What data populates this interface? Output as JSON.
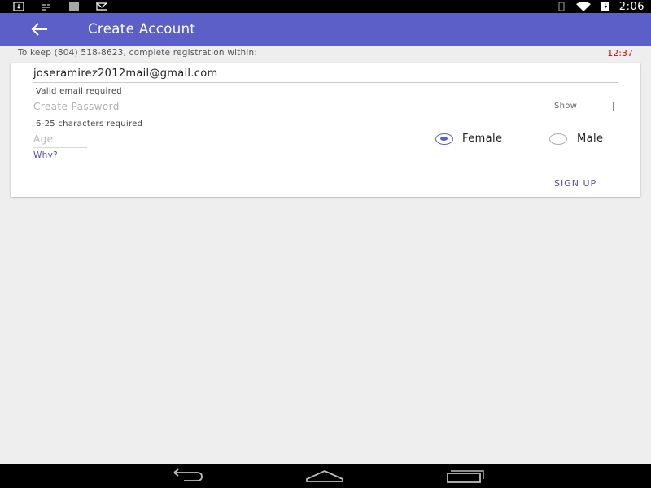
{
  "status_bar": {
    "time": "2:06",
    "left_icons": [
      "download-icon",
      "debug-icon",
      "barcode-icon",
      "mail-icon"
    ],
    "right_icons": [
      "vibrate-icon",
      "wifi-icon",
      "battery-charging-icon"
    ]
  },
  "app_bar": {
    "back_icon": "arrow-back-icon",
    "title": "Create Account",
    "background": "#5b5fc7"
  },
  "registration": {
    "message": "To keep (804) 518-8623, complete registration within:",
    "timer": "12:37",
    "timer_color": "#dd0000"
  },
  "form": {
    "email": {
      "value": "joseramirez2012mail@gmail.com",
      "hint": "Valid email required"
    },
    "password": {
      "placeholder": "Create Password",
      "value": "",
      "show_label": "Show",
      "show_checked": false,
      "hint": "6-25 characters required"
    },
    "age": {
      "placeholder": "Age",
      "value": "",
      "why_link": "Why?"
    },
    "gender": {
      "options": [
        {
          "label": "Female",
          "selected": true
        },
        {
          "label": "Male",
          "selected": false
        }
      ]
    },
    "signup_label": "SIGN UP",
    "accent": "#5b5fc7"
  },
  "nav_bar": {
    "buttons": [
      "back-nav-icon",
      "home-nav-icon",
      "recent-apps-icon"
    ]
  }
}
